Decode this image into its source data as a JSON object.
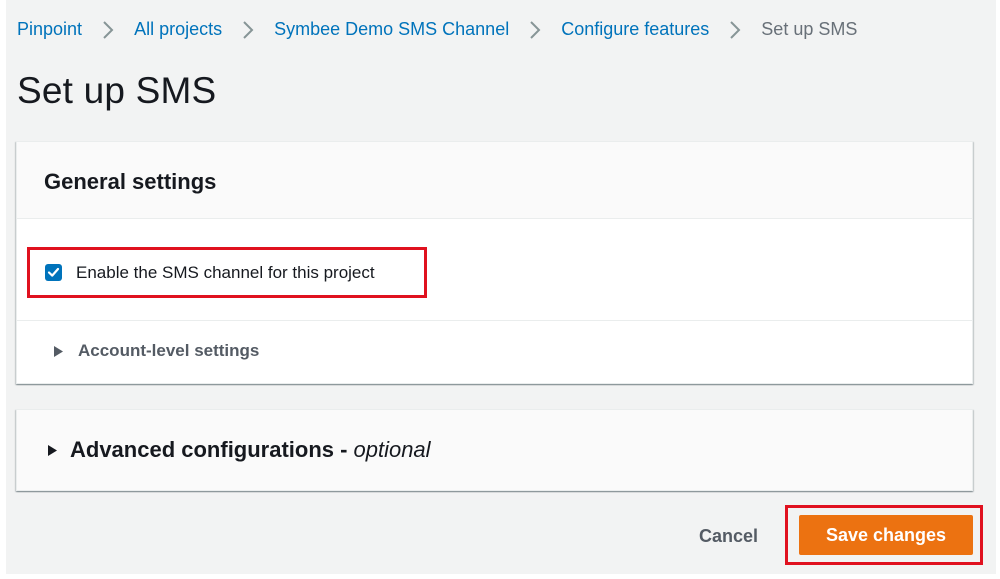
{
  "breadcrumb": {
    "items": [
      {
        "label": "Pinpoint"
      },
      {
        "label": "All projects"
      },
      {
        "label": "Symbee Demo SMS Channel"
      },
      {
        "label": "Configure features"
      }
    ],
    "current": "Set up SMS",
    "separator_icon": "chevron-right-icon"
  },
  "page": {
    "title": "Set up SMS"
  },
  "general_settings": {
    "title": "General settings",
    "enable_sms": {
      "label": "Enable the SMS channel for this project",
      "checked": true
    },
    "account_level": {
      "label": "Account-level settings",
      "expanded": false
    }
  },
  "advanced": {
    "label": "Advanced configurations -",
    "optional": "optional",
    "expanded": false
  },
  "actions": {
    "cancel": "Cancel",
    "save": "Save changes"
  },
  "colors": {
    "link": "#0073bb",
    "primary_button": "#ec7211",
    "highlight_box": "#e0111f",
    "checkbox": "#0073bb",
    "background": "#f2f3f3"
  }
}
